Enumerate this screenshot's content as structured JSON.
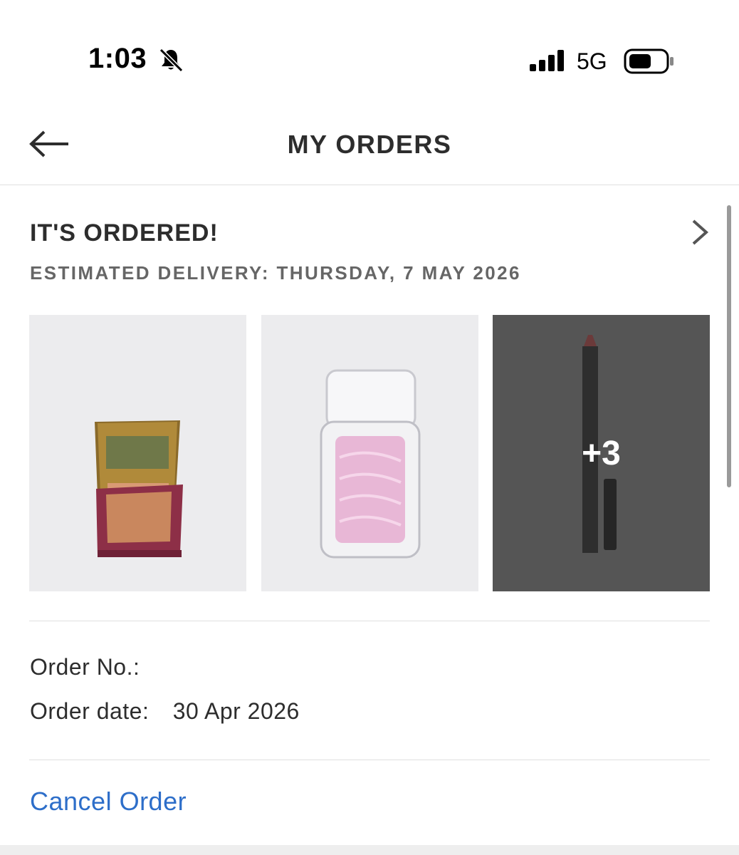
{
  "status_bar": {
    "time": "1:03",
    "network": "5G",
    "icons": [
      "bell-slash-icon",
      "cellular-signal-icon",
      "battery-icon"
    ]
  },
  "header": {
    "title": "MY ORDERS",
    "back_icon": "arrow-left-icon"
  },
  "order": {
    "status": "IT'S ORDERED!",
    "estimated_delivery": "ESTIMATED DELIVERY: THURSDAY, 7 MAY 2026",
    "items_more_label": "+3",
    "order_number_label": "Order No.:",
    "order_number_value": "",
    "order_date_label": "Order date:",
    "order_date_value": "30 Apr 2026",
    "cancel_label": "Cancel Order"
  },
  "colors": {
    "text": "#2d2d2d",
    "muted": "#666666",
    "link": "#2d6ec9",
    "overlay": "#555555"
  }
}
